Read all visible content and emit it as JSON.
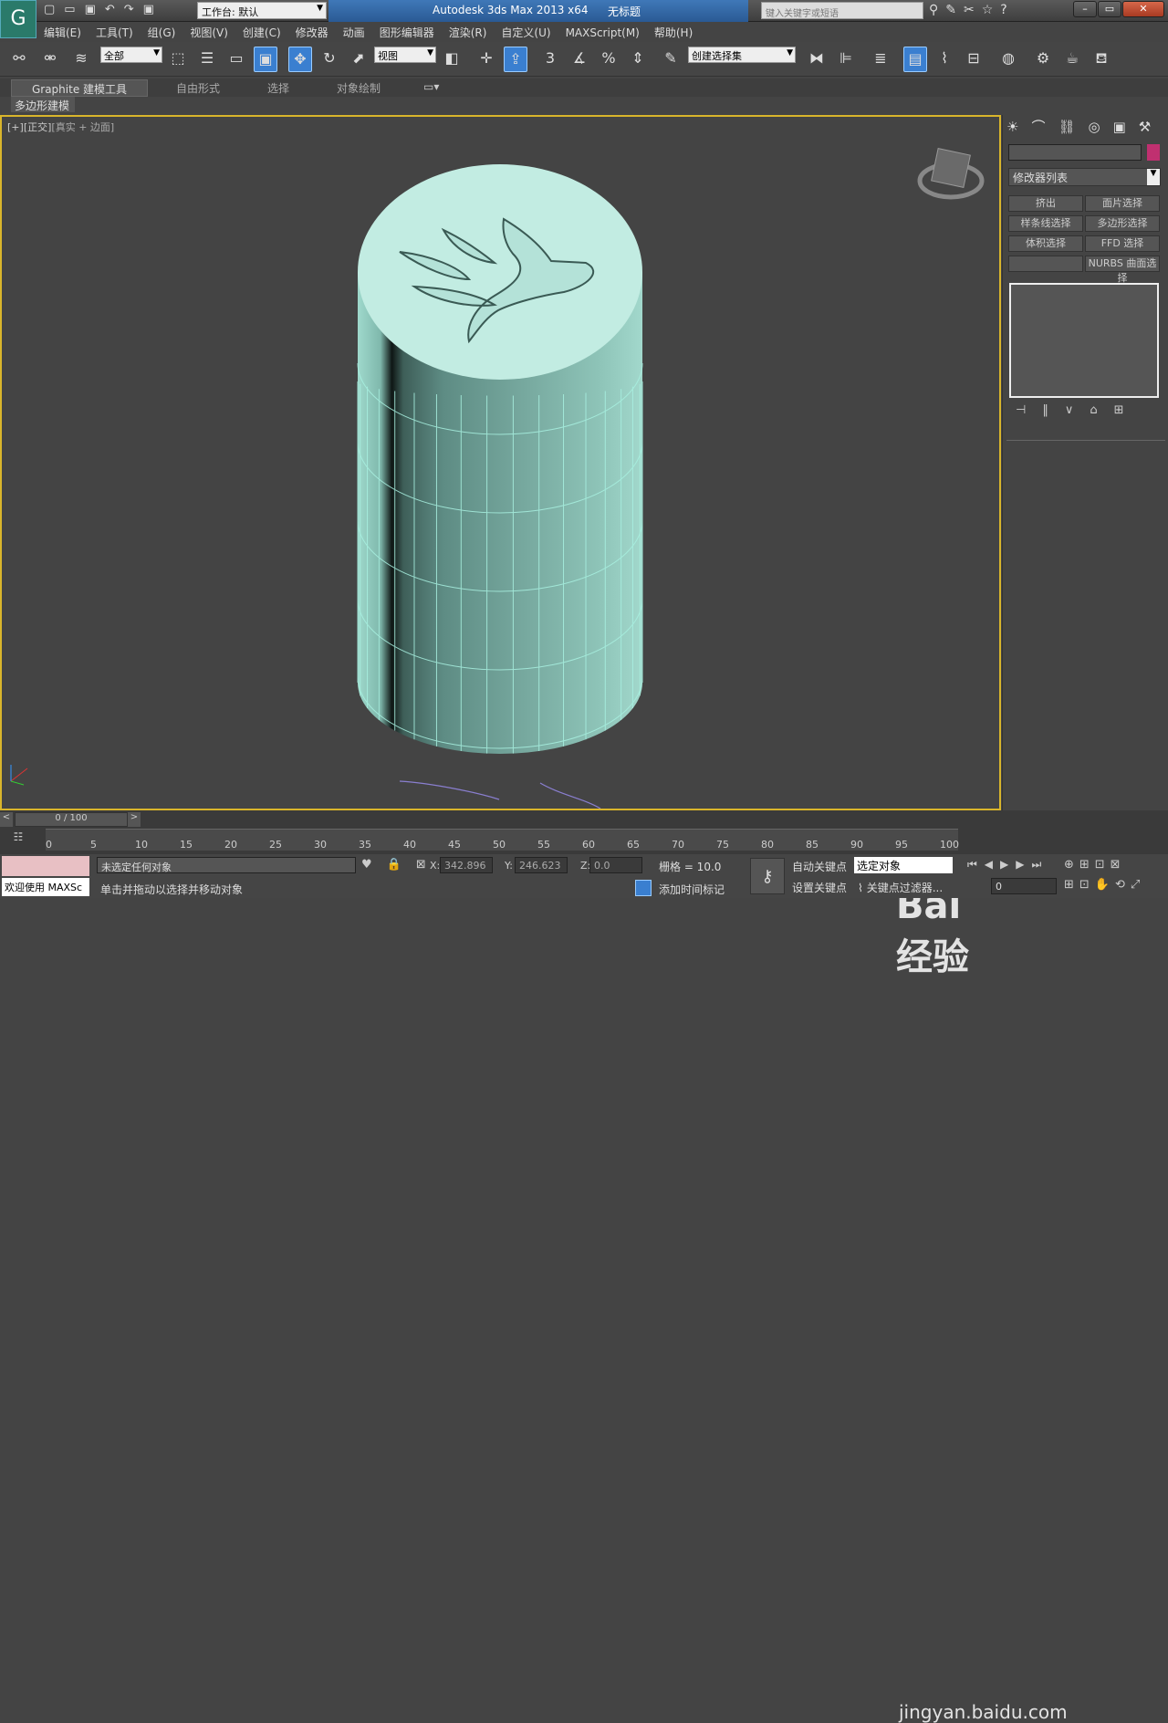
{
  "title": {
    "app": "Autodesk 3ds Max  2013 x64",
    "doc": "无标题",
    "workspace": "工作台: 默认",
    "search_placeholder": "键入关键字或短语"
  },
  "menu": [
    "编辑(E)",
    "工具(T)",
    "组(G)",
    "视图(V)",
    "创建(C)",
    "修改器",
    "动画",
    "图形编辑器",
    "渲染(R)",
    "自定义(U)",
    "MAXScript(M)",
    "帮助(H)"
  ],
  "toolbar": {
    "filter": "全部",
    "refcoord": "视图",
    "selset": "创建选择集",
    "snap3": "3",
    "snappct": "%"
  },
  "ribbon": {
    "tabs": [
      "Graphite 建模工具",
      "自由形式",
      "选择",
      "对象绘制"
    ],
    "sub": "多边形建模"
  },
  "viewport": {
    "label_plus": "[+]",
    "label_view": "[正交]",
    "label_shade": "[真实 + 边面]"
  },
  "panel": {
    "modlist": "修改器列表",
    "buttons": [
      "挤出",
      "面片选择",
      "样条线选择",
      "多边形选择",
      "体积选择",
      "FFD 选择",
      "",
      "NURBS 曲面选择"
    ]
  },
  "timeline": {
    "frame": "0 / 100",
    "ticks": [
      "0",
      "5",
      "10",
      "15",
      "20",
      "25",
      "30",
      "35",
      "40",
      "45",
      "50",
      "55",
      "60",
      "65",
      "70",
      "75",
      "80",
      "85",
      "90",
      "95",
      "100"
    ]
  },
  "status": {
    "msg1": "未选定任何对象",
    "msg2": "单击并拖动以选择并移动对象",
    "welcome": "欢迎使用 MAXSc",
    "x": "342.896",
    "y": "246.623",
    "z": "0.0",
    "grid": "栅格 = 10.0",
    "autokey": "自动关键点",
    "setkey": "设置关键点",
    "selobj": "选定对象",
    "keyfilter": "关键点过滤器...",
    "addtime": "添加时间标记",
    "frameval": "0"
  },
  "watermark": {
    "brand": "Bai 经验",
    "url": "jingyan.baidu.com"
  }
}
